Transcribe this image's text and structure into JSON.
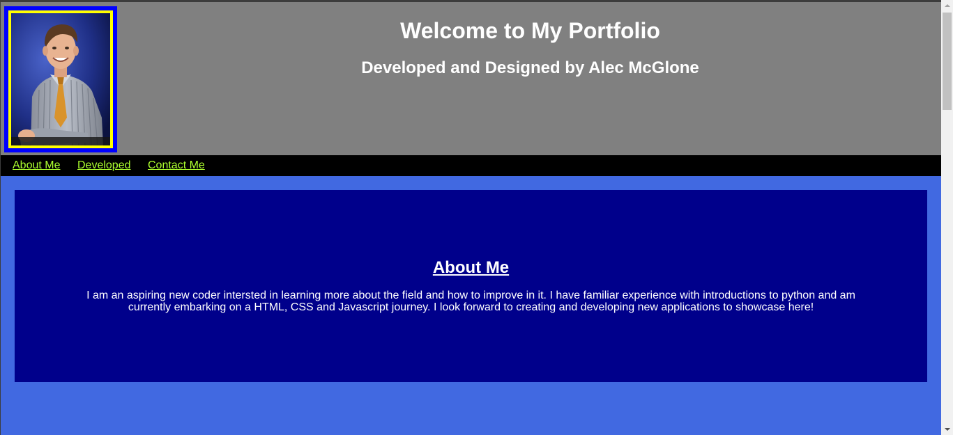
{
  "header": {
    "title": "Welcome to My Portfolio",
    "subtitle": "Developed and Designed by Alec McGlone",
    "photo_alt": "portrait photo"
  },
  "nav": {
    "items": [
      {
        "label": "About Me"
      },
      {
        "label": "Developed"
      },
      {
        "label": "Contact Me"
      }
    ]
  },
  "about": {
    "heading": "About Me",
    "text": "I am an aspiring new coder intersted in learning more about the field and how to improve in it. I have familiar experience with introductions to python and am currently embarking on a HTML, CSS and Javascript journey. I look forward to creating and developing new applications to showcase here!"
  },
  "colors": {
    "header_bg": "#808080",
    "nav_bg": "#000000",
    "nav_link": "#adff2f",
    "page_bg": "#4169e1",
    "card_bg": "#00008b",
    "frame_outer": "#0000ff",
    "frame_inner": "#ffff00"
  }
}
